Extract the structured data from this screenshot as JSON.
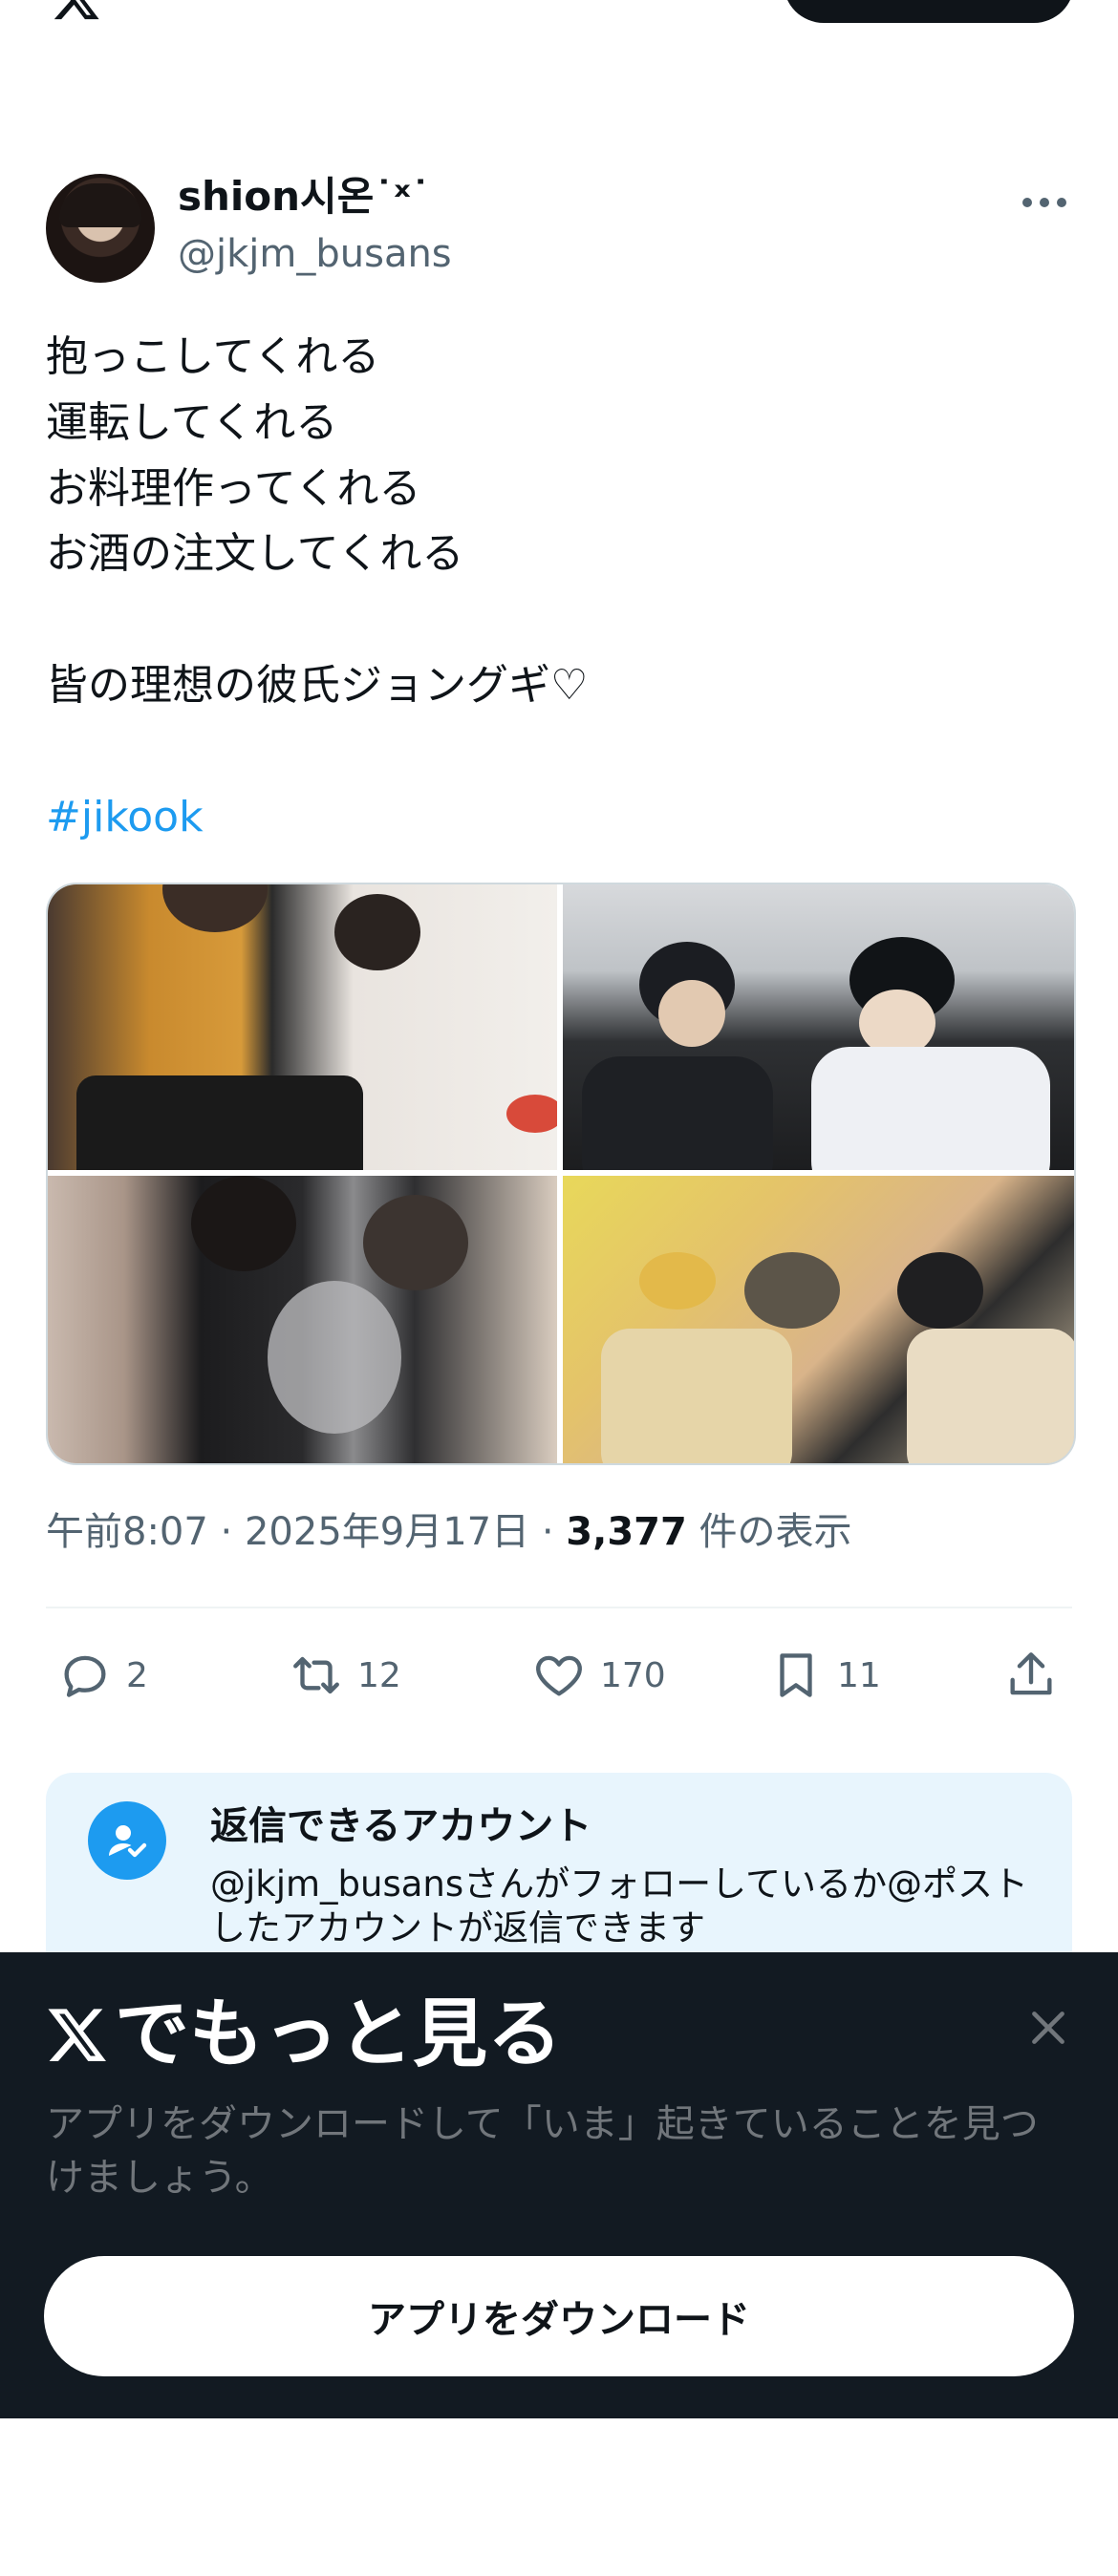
{
  "author": {
    "name": "shion시온˙ˣ˙",
    "handle": "@jkjm_busans"
  },
  "tweet": {
    "text": "抱っこしてくれる\n運転してくれる\nお料理作ってくれる\nお酒の注文してくれる\n\n皆の理想の彼氏ジョングギ♡",
    "hashtag": "#jikook"
  },
  "meta": {
    "time": "午前8:07",
    "date": "2025年9月17日",
    "views_count": "3,377",
    "views_label": "件の表示",
    "separator": " · "
  },
  "actions": {
    "replies": "2",
    "reposts": "12",
    "likes": "170",
    "bookmarks": "11"
  },
  "reply_notice": {
    "title": "返信できるアカウント",
    "description": "@jkjm_busansさんがフォローしているか@ポストしたアカウントが返信できます"
  },
  "sheet": {
    "title": "でもっと見る",
    "description": "アプリをダウンロードして「いま」起きていることを見つけましょう。",
    "button": "アプリをダウンロード"
  },
  "icons": {
    "logo": "x-logo-icon",
    "more": "more-icon",
    "reply": "reply-icon",
    "repost": "repost-icon",
    "like": "heart-icon",
    "bookmark": "bookmark-icon",
    "share": "share-icon",
    "close": "close-icon",
    "reply_permission": "user-check-icon"
  },
  "colors": {
    "link": "#1d9bf0",
    "secondary_text": "#536471",
    "sheet_bg": "#121a22",
    "reply_box_bg": "#e8f5fd"
  }
}
